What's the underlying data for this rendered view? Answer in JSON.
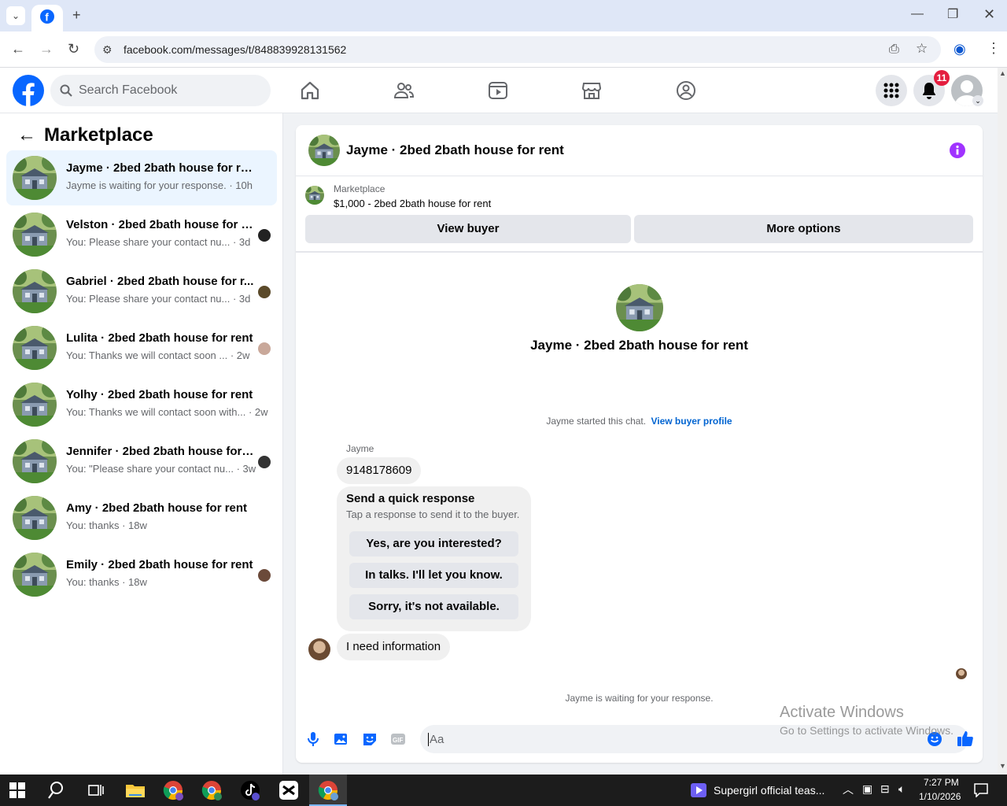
{
  "browser": {
    "url": "facebook.com/messages/t/848839928131562",
    "tab_icon": "facebook-icon"
  },
  "fb": {
    "search_placeholder": "Search Facebook",
    "notifications_badge": "11"
  },
  "sidebar": {
    "title": "Marketplace",
    "conversations": [
      {
        "name": "Jayme · 2bed 2bath house for rent",
        "preview": "Jayme is waiting for your response. · 10h",
        "mini": false
      },
      {
        "name": "Velston · 2bed 2bath house for r...",
        "preview": "You: Please share your contact nu...  · 3d",
        "mini": "#222"
      },
      {
        "name": "Gabriel · 2bed 2bath house for r...",
        "preview": "You: Please share your contact nu...  · 3d",
        "mini": "#5b4a2a"
      },
      {
        "name": "Lulita · 2bed 2bath house for rent",
        "preview": "You: Thanks we will contact soon ...  · 2w",
        "mini": "#c9a89a"
      },
      {
        "name": "Yolhy · 2bed 2bath house for rent",
        "preview": "You: Thanks we will contact soon with... · 2w",
        "mini": false
      },
      {
        "name": "Jennifer · 2bed 2bath house for ...",
        "preview": "You: \"Please share your contact nu... · 3w",
        "mini": "#333"
      },
      {
        "name": "Amy · 2bed 2bath house for rent",
        "preview": "You: thanks · 18w",
        "mini": false
      },
      {
        "name": "Emily · 2bed 2bath house for rent",
        "preview": "You: thanks · 18w",
        "mini": "#6b4a3a"
      }
    ]
  },
  "chat": {
    "title": "Jayme · 2bed 2bath house for rent",
    "listing_label": "Marketplace",
    "listing_price": "$1,000 - 2bed 2bath house for rent",
    "view_buyer": "View buyer",
    "more_options": "More options",
    "center_title": "Jayme · 2bed 2bath house for rent",
    "started_text": "Jayme started this chat.",
    "view_profile": "View buyer profile",
    "sender_name": "Jayme",
    "message1": "9148178609",
    "quick_title": "Send a quick response",
    "quick_sub": "Tap a response to send it to the buyer.",
    "quick_options": [
      "Yes, are you interested?",
      "In talks. I'll let you know.",
      "Sorry, it's not available."
    ],
    "message2": "I need information",
    "waiting": "Jayme is waiting for your response.",
    "composer_placeholder": "Aa",
    "watermark_title": "Activate Windows",
    "watermark_sub": "Go to Settings to activate Windows."
  },
  "taskbar": {
    "media": "Supergirl official teas...",
    "time": "7:27 PM",
    "date": "1/10/2026"
  },
  "colors": {
    "fb_blue": "#0866ff",
    "badge_red": "#e41e3f",
    "info_purple": "#a033ff",
    "link_blue": "#0064d1"
  }
}
